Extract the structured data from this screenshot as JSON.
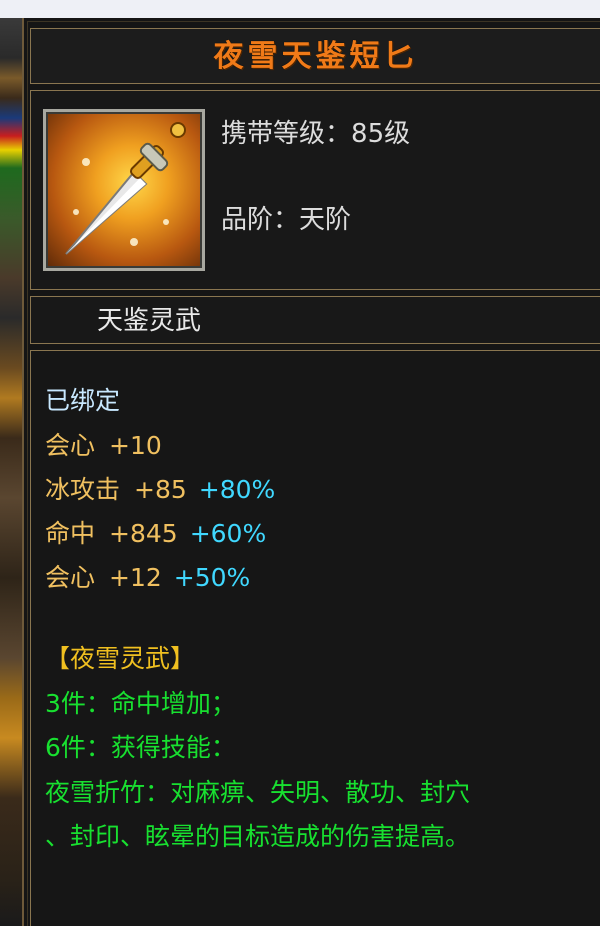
{
  "item": {
    "name": "夜雪天鉴短匕",
    "level_label": "携带等级",
    "level_value": "85级",
    "grade_label": "品阶",
    "grade_value": "天阶",
    "category": "天鉴灵武"
  },
  "attributes": {
    "bound": "已绑定",
    "base": [
      {
        "name": "会心",
        "value": "+10",
        "pct": ""
      }
    ],
    "extra": [
      {
        "name": "冰攻击",
        "value": "+85",
        "pct": "+80%"
      },
      {
        "name": "命中",
        "value": "+845",
        "pct": "+60%"
      },
      {
        "name": "会心",
        "value": "+12",
        "pct": "+50%"
      }
    ]
  },
  "set": {
    "title": "【夜雪灵武】",
    "bonus3": "3件：命中增加；",
    "bonus6": "6件：获得技能：",
    "skill_line1": "夜雪折竹：对麻痹、失明、散功、封穴",
    "skill_line2": "、封印、眩晕的目标造成的伤害提高。"
  },
  "colors": {
    "title": "#f07a18",
    "stat": "#f0c060",
    "pct": "#40d8ff",
    "set_text": "#18e030"
  },
  "icon": "dagger-icon"
}
